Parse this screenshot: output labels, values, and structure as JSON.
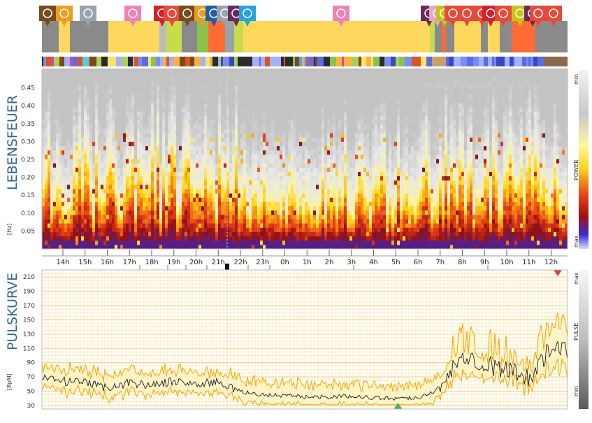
{
  "sections": {
    "upper_title": "LEBENSFEUER",
    "upper_unit": "[Hz]",
    "lower_title": "PULSKURVE",
    "lower_unit": "[BpM]"
  },
  "watermark": "© AUTONOM HEALTH",
  "scales": {
    "power": {
      "label": "POWER",
      "top": "min",
      "bottom": "max"
    },
    "pulse": {
      "label": "PULSE",
      "top": "max",
      "bottom": "min"
    }
  },
  "time_axis": [
    "14h",
    "15h",
    "16h",
    "17h",
    "18h",
    "19h",
    "20h",
    "21h",
    "22h",
    "23h",
    "0h",
    "1h",
    "2h",
    "3h",
    "4h",
    "5h",
    "6h",
    "7h",
    "8h",
    "9h",
    "10h",
    "11h",
    "12h"
  ],
  "colors": {
    "sleep_yellow": "#fdd85d",
    "pulse_band": "#f5a400",
    "pulse_line": "#1a1a1a",
    "marker_up": "#4caf50",
    "marker_down": "#e53935",
    "title_blue": "#2f6496"
  },
  "activity_icons": [
    {
      "icon": "walk-icon",
      "color": "#7a4a1c"
    },
    {
      "icon": "food-icon",
      "color": "#f29c1f"
    },
    {
      "icon": "screen-icon",
      "color": "#9aa3ad"
    },
    {
      "icon": "bed-icon",
      "color": "#ee82b4"
    },
    {
      "icon": "question-icon",
      "color": "#d4202a"
    },
    {
      "icon": "walk-icon",
      "color": "#e8493a"
    },
    {
      "icon": "walk-icon",
      "color": "#7a4a1c"
    },
    {
      "icon": "food-icon",
      "color": "#f29c1f"
    },
    {
      "icon": "keyboard-icon",
      "color": "#1f5fa8"
    },
    {
      "icon": "fork-icon",
      "color": "#9aa3ad"
    },
    {
      "icon": "relax-icon",
      "color": "#6b2a5a"
    },
    {
      "icon": "phone-icon",
      "color": "#27a2e0"
    },
    {
      "icon": "bed-icon",
      "color": "#ee82b4"
    },
    {
      "icon": "relax-icon",
      "color": "#6b2a5a"
    },
    {
      "icon": "relax-icon",
      "color": "#e6a7c6"
    },
    {
      "icon": "relax-icon",
      "color": "#c7c417"
    },
    {
      "icon": "walk-icon",
      "color": "#e8493a"
    },
    {
      "icon": "walk-icon",
      "color": "#e8493a"
    },
    {
      "icon": "walk-icon",
      "color": "#e8493a"
    },
    {
      "icon": "question-icon",
      "color": "#d4202a"
    },
    {
      "icon": "walk-icon",
      "color": "#e8493a"
    },
    {
      "icon": "walk-icon",
      "color": "#c7c417"
    },
    {
      "icon": "relax-icon",
      "color": "#6b2a5a"
    },
    {
      "icon": "walk-icon",
      "color": "#e8493a"
    },
    {
      "icon": "walk-icon",
      "color": "#e8493a"
    }
  ],
  "chart_data": [
    {
      "type": "heatmap",
      "title": "LEBENSFEUER",
      "ylabel": "[Hz]",
      "yticks": [
        0.05,
        0.1,
        0.15,
        0.2,
        0.25,
        0.3,
        0.35,
        0.4,
        0.45
      ],
      "ylim": [
        0,
        0.5
      ],
      "x_categories": [
        "14h",
        "15h",
        "16h",
        "17h",
        "18h",
        "19h",
        "20h",
        "21h",
        "22h",
        "23h",
        "0h",
        "1h",
        "2h",
        "3h",
        "4h",
        "5h",
        "6h",
        "7h",
        "8h",
        "9h",
        "10h",
        "11h",
        "12h"
      ],
      "colorscale_label": "POWER"
    },
    {
      "type": "line",
      "title": "PULSKURVE",
      "ylabel": "[BpM]",
      "yticks": [
        30,
        50,
        70,
        90,
        110,
        130,
        150,
        170,
        190,
        210
      ],
      "ylim": [
        25,
        220
      ],
      "grid": true,
      "x": [
        "13.2h",
        "14h",
        "15h",
        "16h",
        "17h",
        "18h",
        "19h",
        "20h",
        "21h",
        "22h",
        "23h",
        "0h",
        "1h",
        "2h",
        "3h",
        "4h",
        "5h",
        "6h",
        "7h",
        "8h",
        "9h",
        "10h",
        "11h",
        "12h",
        "12.7h"
      ],
      "series": [
        {
          "name": "",
          "values": [
            68,
            64,
            61,
            55,
            62,
            58,
            64,
            60,
            63,
            49,
            45,
            44,
            42,
            42,
            43,
            41,
            40,
            41,
            53,
            105,
            88,
            80,
            70,
            110,
            105
          ]
        }
      ],
      "markers": [
        {
          "shape": "triangle-down",
          "label": "max",
          "x": "12.3h",
          "y": 210
        },
        {
          "shape": "triangle-up",
          "label": "min",
          "x": "5.1h",
          "y": 30
        }
      ]
    }
  ]
}
